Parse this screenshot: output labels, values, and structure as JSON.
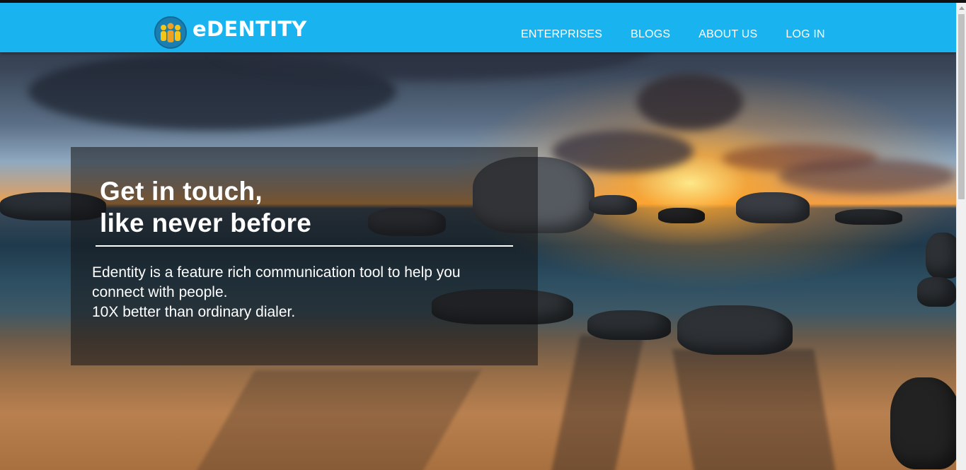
{
  "brand": {
    "name": "eDENTITY",
    "logo_icon": "people-group-icon",
    "colors": {
      "navbar": "#19b4f0",
      "logo_bg": "#1a7fb0",
      "person_left": "#f5c518",
      "person_center": "#f0a020",
      "person_right": "#f5c518"
    }
  },
  "nav": {
    "items": [
      {
        "label": "ENTERPRISES"
      },
      {
        "label": "BLOGS"
      },
      {
        "label": "ABOUT US"
      },
      {
        "label": "LOG IN"
      }
    ]
  },
  "hero": {
    "headline_line1": "Get in touch,",
    "headline_line2": "like never before",
    "tagline_line1": "Edentity is a feature rich communication tool to help you",
    "tagline_line2": "connect with people.",
    "tagline_line3": "10X better than ordinary dialer.",
    "background_image": "sunset-beach-with-rocks"
  }
}
